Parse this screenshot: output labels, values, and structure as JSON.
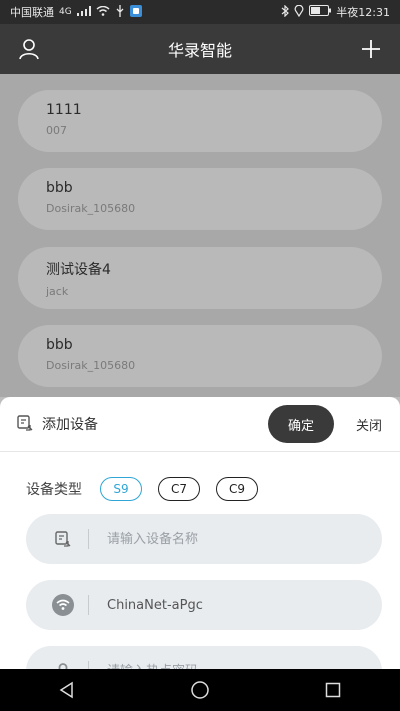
{
  "status_bar": {
    "carrier": "中国联通",
    "network": "4G",
    "time_label": "半夜12:31"
  },
  "app_bar": {
    "title": "华录智能"
  },
  "devices": [
    {
      "name": "1111",
      "sub": "007"
    },
    {
      "name": "bbb",
      "sub": "Dosirak_105680"
    },
    {
      "name": "测试设备4",
      "sub": "jack"
    },
    {
      "name": "bbb",
      "sub": "Dosirak_105680"
    }
  ],
  "sheet": {
    "title": "添加设备",
    "confirm_label": "确定",
    "close_label": "关闭",
    "type_label": "设备类型",
    "types": [
      {
        "label": "S9",
        "selected": true
      },
      {
        "label": "C7",
        "selected": false
      },
      {
        "label": "C9",
        "selected": false
      }
    ],
    "name_field": {
      "placeholder": "请输入设备名称",
      "value": ""
    },
    "wifi_field": {
      "value": "ChinaNet-aPgc"
    },
    "password_field": {
      "placeholder": "请输入热点密码"
    }
  },
  "colors": {
    "accent": "#2fa6d6",
    "dark": "#3a3a3a"
  }
}
